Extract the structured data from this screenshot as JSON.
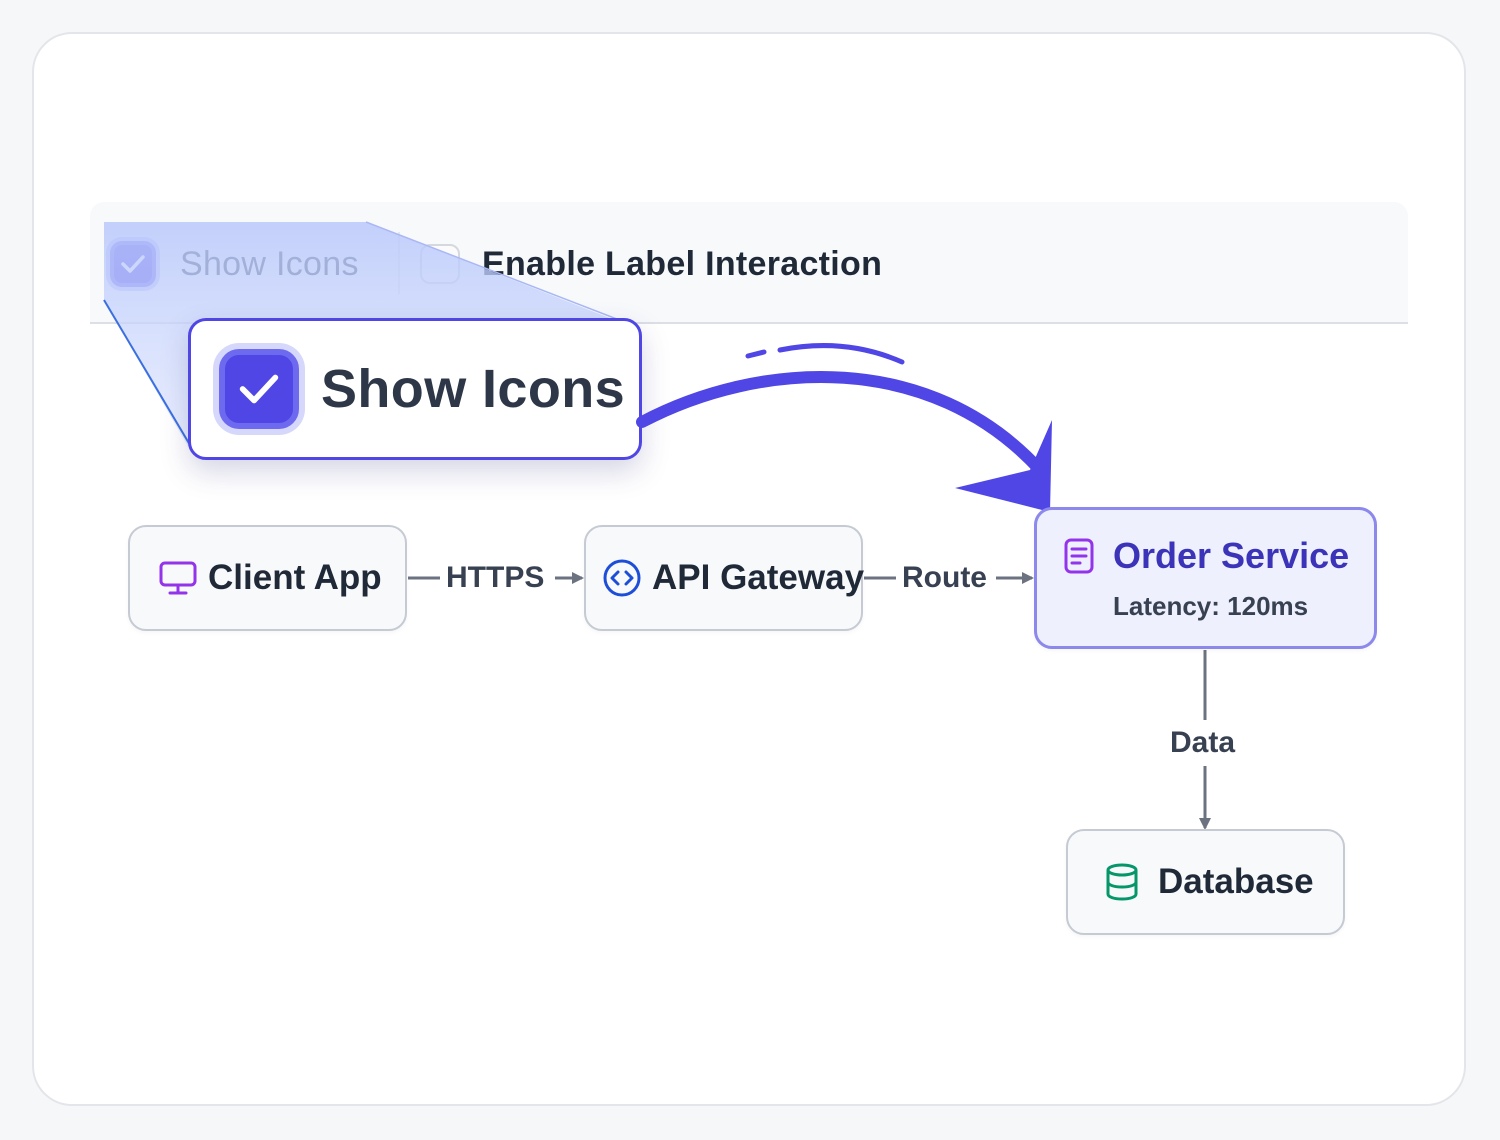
{
  "toolbar": {
    "show_icons_label": "Show Icons",
    "show_icons_checked": true,
    "enable_label_interaction_label": "Enable Label Interaction",
    "enable_label_interaction_checked": false
  },
  "zoom_callout": {
    "label": "Show Icons"
  },
  "diagram": {
    "nodes": {
      "client": {
        "label": "Client App",
        "icon": "monitor-icon"
      },
      "gateway": {
        "label": "API Gateway",
        "icon": "code-circle-icon"
      },
      "order": {
        "label": "Order Service",
        "subtitle": "Latency: 120ms",
        "icon": "document-icon"
      },
      "database": {
        "label": "Database",
        "icon": "database-icon"
      }
    },
    "edges": {
      "client_gateway": "HTTPS",
      "gateway_order": "Route",
      "order_database": "Data"
    }
  },
  "colors": {
    "accent": "#4f46e5",
    "order_bg": "#eef0fe",
    "client_icon": "#9333ea",
    "gateway_icon": "#1d4ed8",
    "db_icon": "#059669",
    "edge": "#6b7280"
  }
}
